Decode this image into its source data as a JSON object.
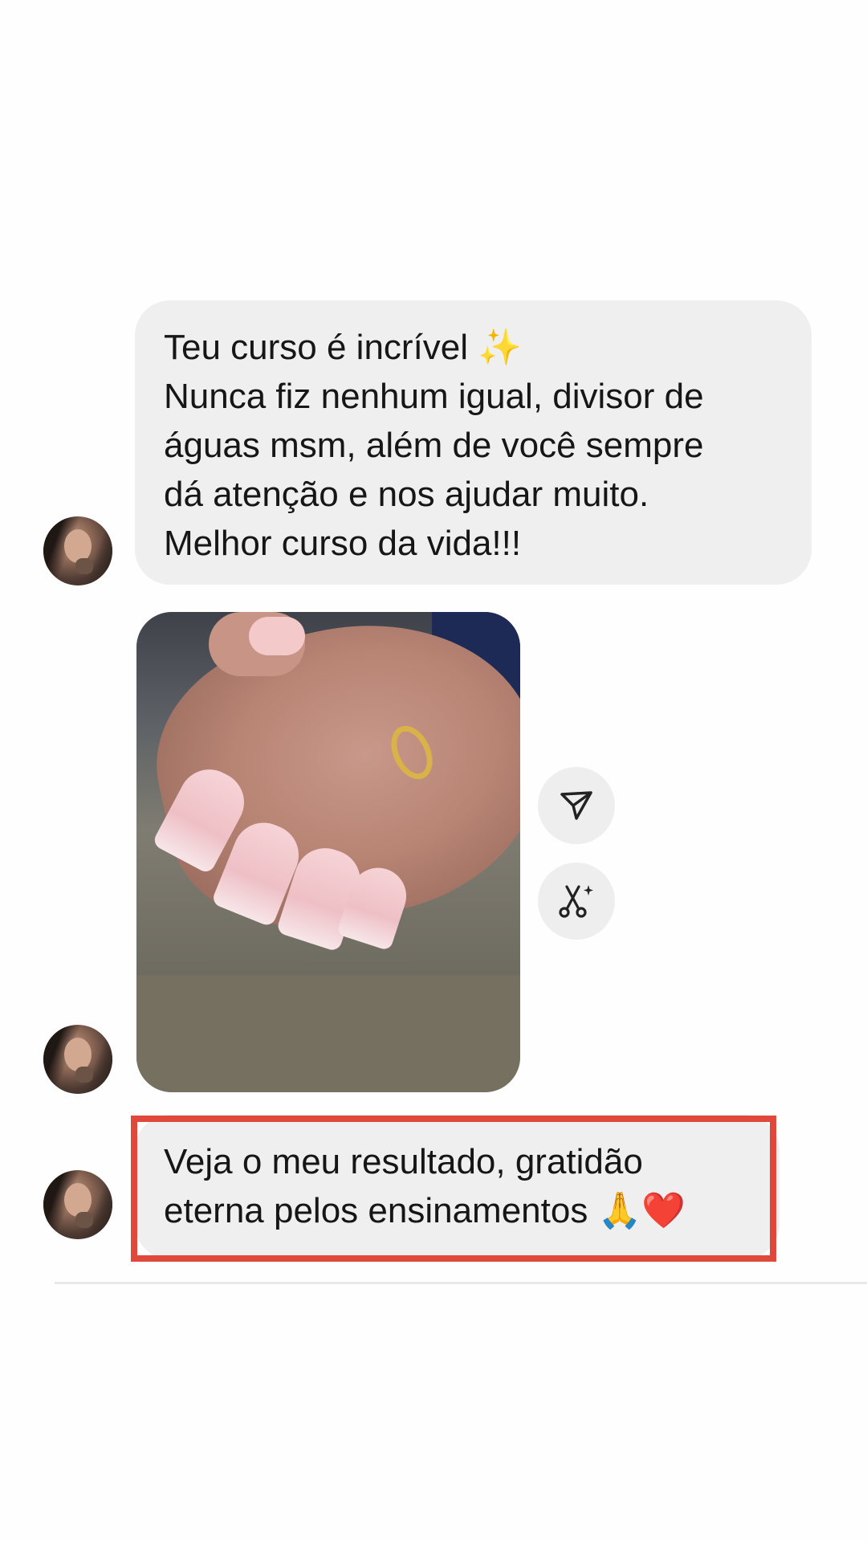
{
  "messages": [
    {
      "type": "text",
      "lines": [
        "Teu curso é incrível ✨",
        "Nunca fiz nenhum igual, divisor de",
        "águas msm, além de você sempre",
        "dá atenção e nos ajudar muito.",
        "Melhor curso da vida!!!"
      ]
    },
    {
      "type": "image",
      "image_description_icon": "photo-of-manicured-nails",
      "actions": [
        "send-icon",
        "ai-edit-scissors-icon"
      ]
    },
    {
      "type": "text",
      "lines": [
        "Veja o meu resultado, gratidão",
        "eterna pelos ensinamentos 🙏❤️"
      ],
      "highlighted": true
    }
  ],
  "colors": {
    "bubble": "#efefef",
    "highlight": "#e0483c",
    "background": "#fefefe"
  }
}
